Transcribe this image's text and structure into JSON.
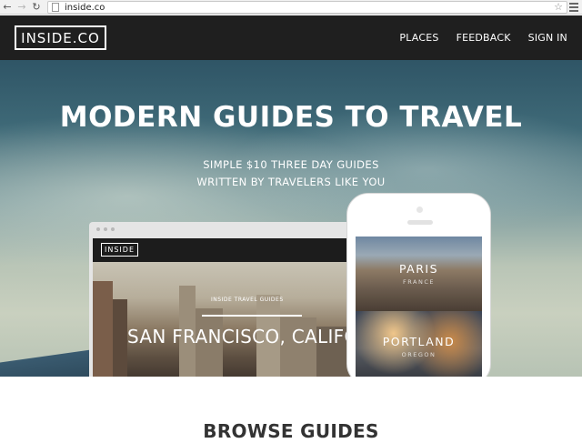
{
  "browser": {
    "url": "inside.co",
    "back_icon": "arrow-left-icon",
    "forward_icon": "arrow-right-icon",
    "reload_icon": "reload-icon",
    "star_icon": "star-icon",
    "menu_icon": "menu-icon"
  },
  "header": {
    "logo": "INSIDE.CO",
    "nav": [
      "PLACES",
      "FEEDBACK",
      "SIGN IN"
    ]
  },
  "hero": {
    "title": "MODERN GUIDES TO TRAVEL",
    "subtitle_line1": "SIMPLE $10 THREE DAY GUIDES",
    "subtitle_line2": "WRITTEN BY TRAVELERS LIKE YOU"
  },
  "desktop_mock": {
    "logo": "INSIDE",
    "kicker": "INSIDE TRAVEL GUIDES",
    "city": "SAN FRANCISCO, CALIFOR"
  },
  "phone_mock": {
    "cards": [
      {
        "title": "PARIS",
        "subtitle": "FRANCE"
      },
      {
        "title": "PORTLAND",
        "subtitle": "OREGON"
      }
    ]
  },
  "section": {
    "browse_title": "BROWSE GUIDES"
  },
  "colors": {
    "header_bg": "#1f1f1f",
    "text_white": "#ffffff"
  }
}
